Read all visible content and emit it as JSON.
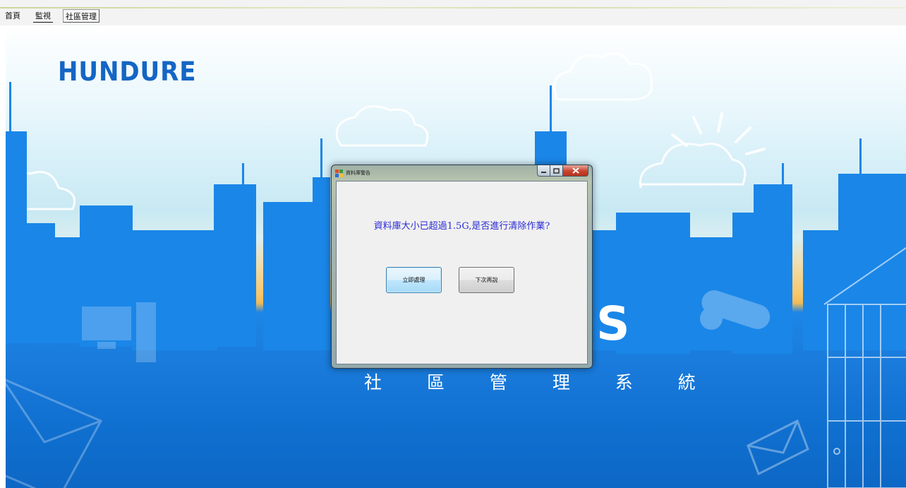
{
  "menu": {
    "items": [
      {
        "label": "首頁"
      },
      {
        "label": "監視"
      },
      {
        "label": "社區管理"
      }
    ]
  },
  "background": {
    "logo": "HUNDURE",
    "subtitle": "社 區 管 理 系 統",
    "partial_letter": "S",
    "colors": {
      "sky": "#d6eff8",
      "sunset": "#f3bb56",
      "buildings": "#1a86e8",
      "ground": "#0d67c5"
    }
  },
  "dialog": {
    "title": "資料庫警告",
    "message": "資料庫大小已超過1.5G,是否進行清除作業?",
    "buttons": {
      "process_now": "立即處理",
      "later": "下次再說"
    },
    "icons": {
      "title": "app-icon",
      "minimize": "minimize-icon",
      "maximize": "maximize-icon",
      "close": "close-icon"
    },
    "colors": {
      "message_text": "#2b2bd6",
      "close_button": "#c8432f"
    }
  }
}
